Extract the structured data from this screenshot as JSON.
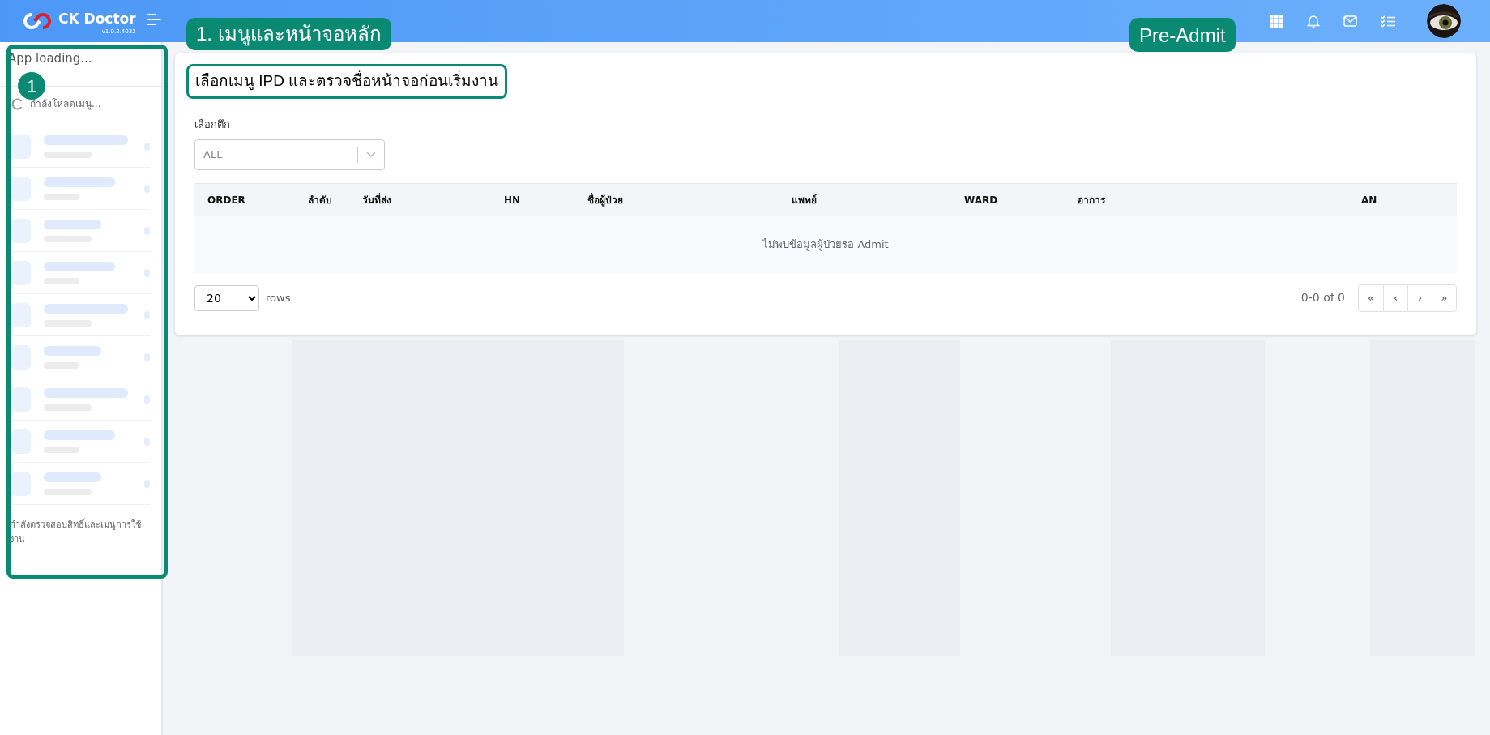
{
  "header": {
    "brand": "CK Doctor",
    "version": "v1.0.2.4032"
  },
  "annotations": [
    {
      "kind": "callout",
      "text": "1. เมนูและหน้าจอหลัก"
    },
    {
      "kind": "callout",
      "text": "Pre-Admit"
    },
    {
      "kind": "step",
      "text": "1"
    },
    {
      "kind": "outline",
      "text": "เลือกเมนู IPD และตรวจชื่อหน้าจอก่อนเริ่มงาน"
    }
  ],
  "sidebar": {
    "title": "App loading...",
    "loading": "กำลังโหลดเมนู...",
    "footer": "กำลังตรวจสอบสิทธิ์และเมนูการใช้งาน"
  },
  "filter": {
    "label": "เลือกตึก",
    "value": "ALL"
  },
  "table": {
    "columns": [
      "ORDER",
      "ลำดับ",
      "วันที่ส่ง",
      "HN",
      "ชื่อผู้ป่วย",
      "แพทย์",
      "WARD",
      "อาการ",
      "AN"
    ],
    "empty": "ไม่พบข้อมูลผู้ป่วยรอ Admit"
  },
  "pagination": {
    "page_size": "20",
    "rows_label": "rows",
    "range": "0-0 of 0",
    "buttons": [
      "«",
      "‹",
      "›",
      "»"
    ]
  }
}
